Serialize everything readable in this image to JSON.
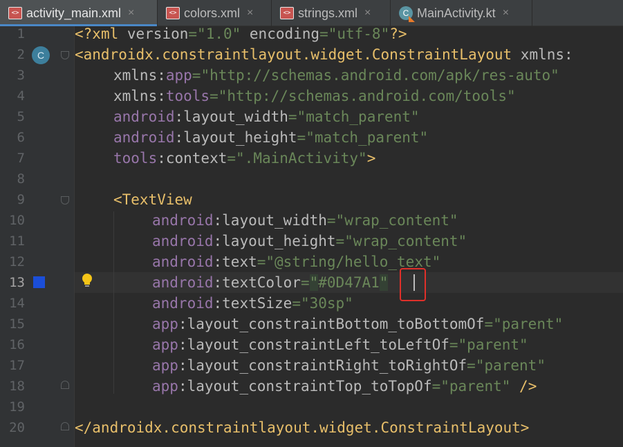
{
  "tabs": [
    {
      "label": "activity_main.xml",
      "type": "xml",
      "active": true
    },
    {
      "label": "colors.xml",
      "type": "xml",
      "active": false
    },
    {
      "label": "strings.xml",
      "type": "xml",
      "active": false
    },
    {
      "label": "MainActivity.kt",
      "type": "kotlin",
      "active": false
    }
  ],
  "close_glyph": "×",
  "gutter_marks": {
    "class_icon": "C"
  },
  "file_icon_text": "<>",
  "current_line": 13,
  "lines": [
    {
      "n": "1"
    },
    {
      "n": "2"
    },
    {
      "n": "3"
    },
    {
      "n": "4"
    },
    {
      "n": "5"
    },
    {
      "n": "6"
    },
    {
      "n": "7"
    },
    {
      "n": "8"
    },
    {
      "n": "9"
    },
    {
      "n": "10"
    },
    {
      "n": "11"
    },
    {
      "n": "12"
    },
    {
      "n": "13"
    },
    {
      "n": "14"
    },
    {
      "n": "15"
    },
    {
      "n": "16"
    },
    {
      "n": "17"
    },
    {
      "n": "18"
    },
    {
      "n": "19"
    },
    {
      "n": "20"
    }
  ],
  "code": {
    "l1": {
      "a": "<?",
      "b": "xml ",
      "c": "version",
      "d": "=",
      "e": "\"1.0\" ",
      "f": "encoding",
      "g": "=",
      "h": "\"utf-8\"",
      "i": "?>"
    },
    "l2": {
      "a": "<androidx.constraintlayout.widget.ConstraintLayout ",
      "b": "xmlns:"
    },
    "l3": {
      "a": "xmlns:",
      "b": "app",
      "c": "=",
      "d": "\"http://schemas.android.com/apk/res-auto\""
    },
    "l4": {
      "a": "xmlns:",
      "b": "tools",
      "c": "=",
      "d": "\"http://schemas.android.com/tools\""
    },
    "l5": {
      "a": "android",
      "b": ":layout_width",
      "c": "=",
      "d": "\"match_parent\""
    },
    "l6": {
      "a": "android",
      "b": ":layout_height",
      "c": "=",
      "d": "\"match_parent\""
    },
    "l7": {
      "a": "tools",
      "b": ":context",
      "c": "=",
      "d": "\".MainActivity\"",
      "e": ">"
    },
    "l9": {
      "a": "<TextView"
    },
    "l10": {
      "a": "android",
      "b": ":layout_width",
      "c": "=",
      "d": "\"wrap_content\""
    },
    "l11": {
      "a": "android",
      "b": ":layout_height",
      "c": "=",
      "d": "\"wrap_content\""
    },
    "l12": {
      "a": "android",
      "b": ":text",
      "c": "=",
      "d": "\"@string/hello_text\""
    },
    "l13": {
      "a": "android",
      "b": ":textColor",
      "c": "=",
      "d": "\"",
      "e": "#0D47A1",
      "f": "\""
    },
    "l14": {
      "a": "android",
      "b": ":textSize",
      "c": "=",
      "d": "\"30sp\""
    },
    "l15": {
      "a": "app",
      "b": ":layout_constraintBottom_toBottomOf",
      "c": "=",
      "d": "\"parent\""
    },
    "l16": {
      "a": "app",
      "b": ":layout_constraintLeft_toLeftOf",
      "c": "=",
      "d": "\"parent\""
    },
    "l17": {
      "a": "app",
      "b": ":layout_constraintRight_toRightOf",
      "c": "=",
      "d": "\"parent\""
    },
    "l18": {
      "a": "app",
      "b": ":layout_constraintTop_toTopOf",
      "c": "=",
      "d": "\"parent\" ",
      "e": "/>"
    },
    "l20": {
      "a": "</androidx.constraintlayout.widget.ConstraintLayout>"
    }
  },
  "colors": {
    "background": "#2b2b2b",
    "gutter": "#313335",
    "tag": "#e8bf6a",
    "namespace": "#9876aa",
    "string": "#6a8759",
    "attribute": "#bababa",
    "color_swatch": "#1b4ed8",
    "highlight_box": "#e0302a"
  },
  "icons": {
    "class_marker": "class-c-icon",
    "color_swatch": "color-swatch-icon",
    "intention": "lightbulb-icon",
    "xml_file": "xml-file-icon",
    "kotlin_file": "kotlin-file-icon"
  }
}
